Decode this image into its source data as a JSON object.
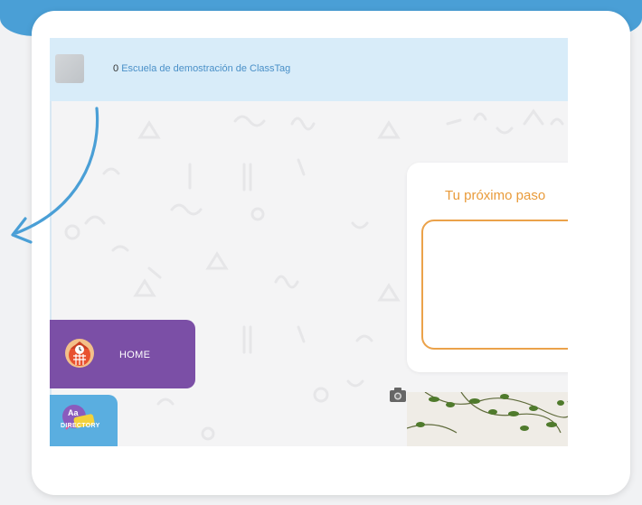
{
  "school_bar": {
    "count": "0",
    "school_name": "Escuela de demostración de ClassTag"
  },
  "next_step": {
    "title": "Tu próximo paso"
  },
  "nav": {
    "home_label": "HOME",
    "directory_label": "DIRECTORY"
  },
  "colors": {
    "banner": "#4a9fd6",
    "school_bar": "#d8ecf9",
    "home_button": "#7b4fa6",
    "directory_button": "#5aaee0",
    "accent_orange": "#eba24a"
  },
  "icons": {
    "home": "house-clock-icon",
    "directory": "directory-badge-icon",
    "camera": "camera-icon",
    "arrow": "curved-arrow-icon"
  }
}
